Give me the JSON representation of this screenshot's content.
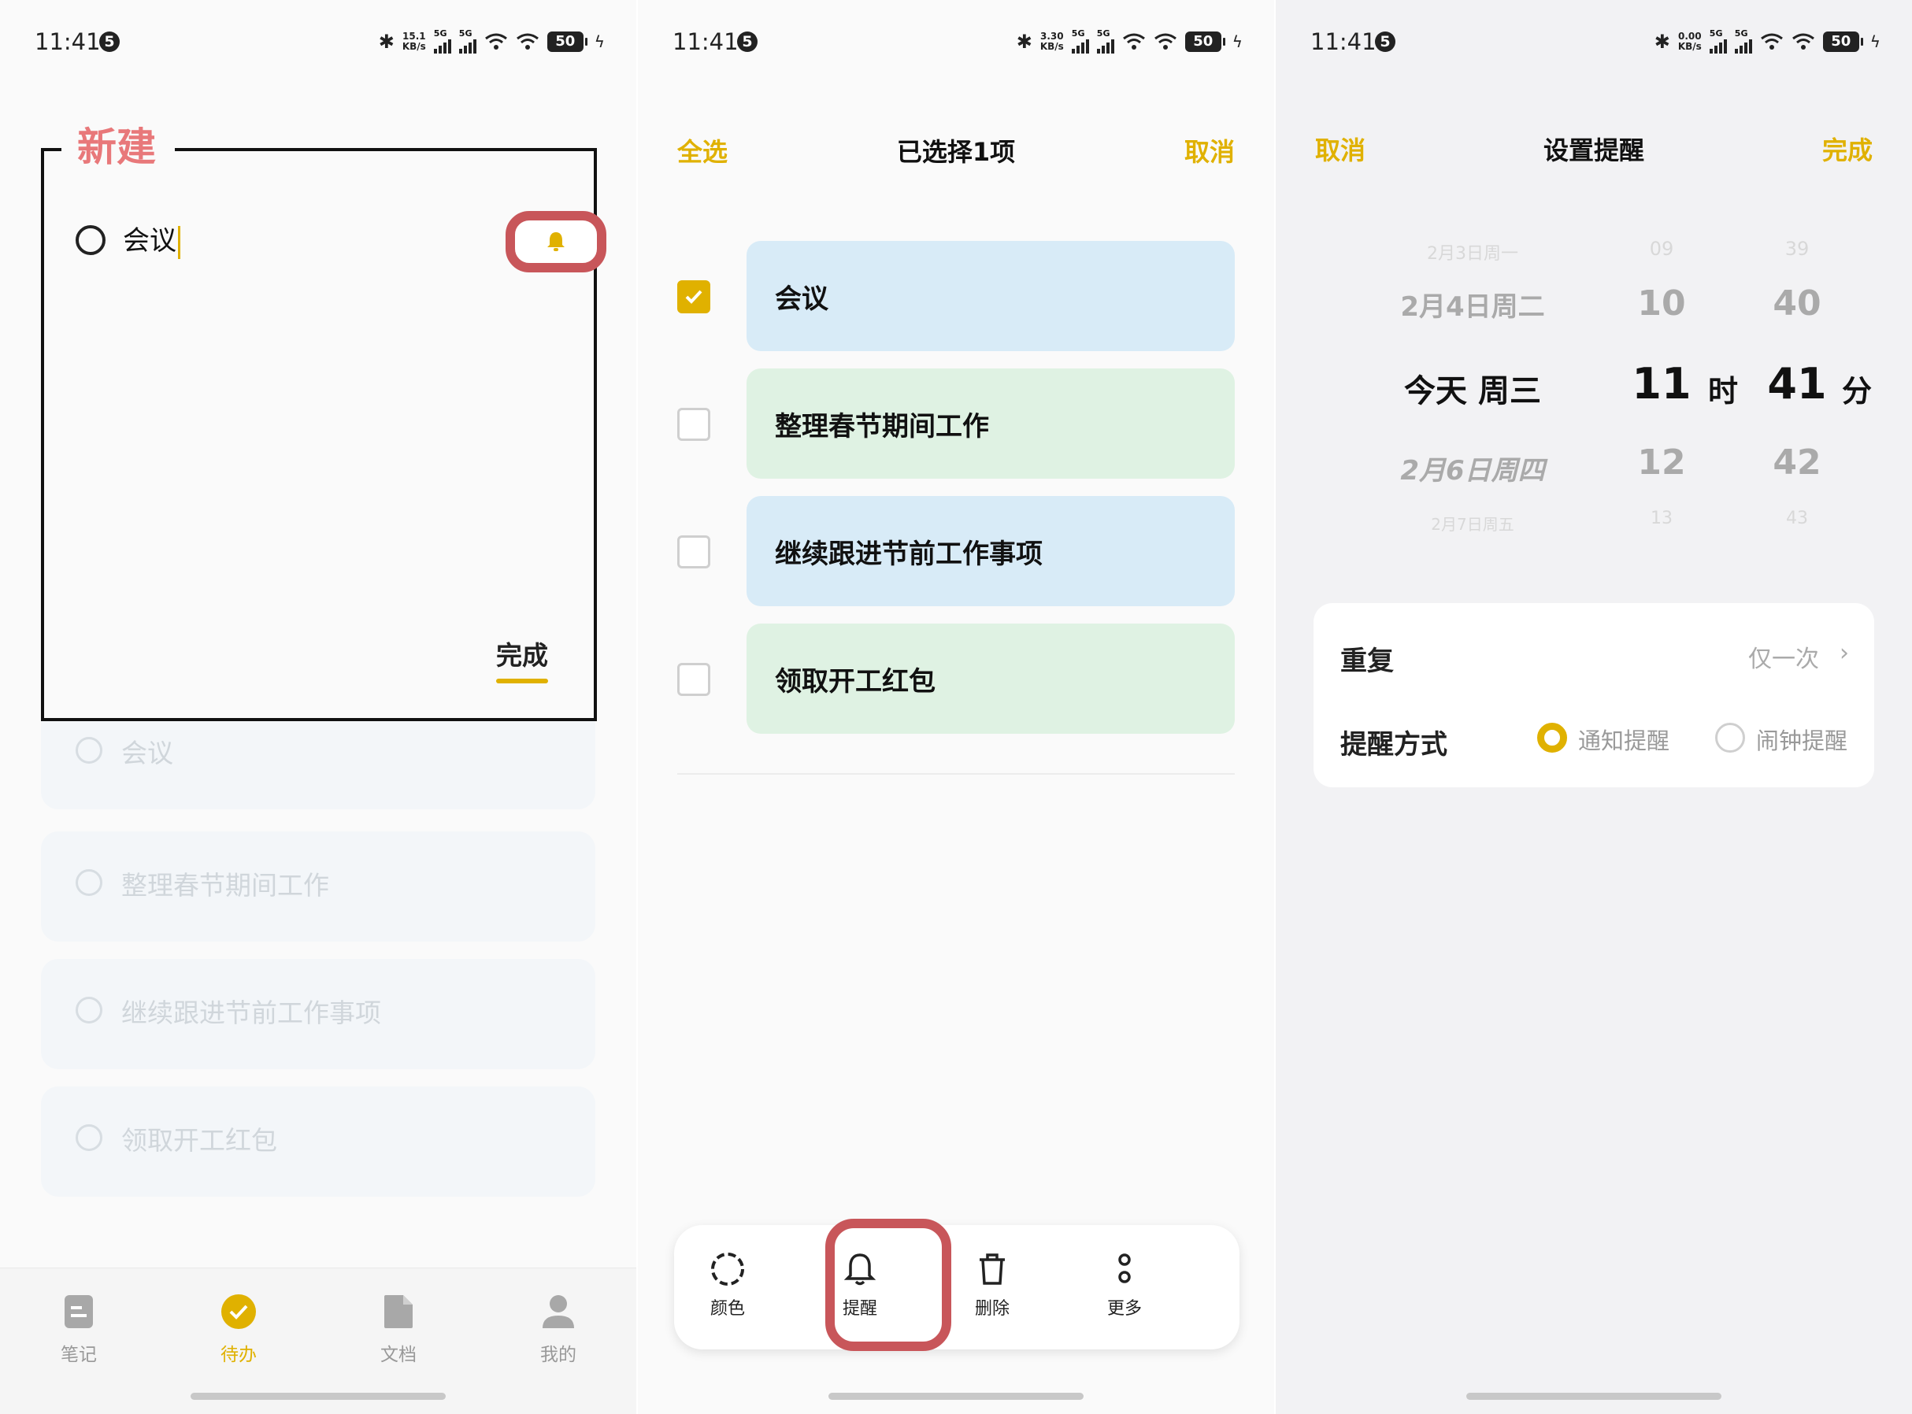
{
  "status": {
    "time": "11:41",
    "badge": "5",
    "speed1": "15.1",
    "speed2": "3.30",
    "speed3": "0.00",
    "speed_unit": "KB/s",
    "net": "5G",
    "battery": "50"
  },
  "panel1": {
    "new_label": "新建",
    "input_value": "会议",
    "done_label": "完成",
    "ghost_items": [
      "会议",
      "整理春节期间工作",
      "继续跟进节前工作事项",
      "领取开工红包"
    ],
    "tabs": [
      {
        "label": "笔记",
        "icon": "note-icon"
      },
      {
        "label": "待办",
        "icon": "check-circle-icon"
      },
      {
        "label": "文档",
        "icon": "document-icon"
      },
      {
        "label": "我的",
        "icon": "person-icon"
      }
    ]
  },
  "panel2": {
    "select_all": "全选",
    "title": "已选择1项",
    "cancel": "取消",
    "items": [
      {
        "label": "会议",
        "checked": true,
        "color": "blue"
      },
      {
        "label": "整理春节期间工作",
        "checked": false,
        "color": "green"
      },
      {
        "label": "继续跟进节前工作事项",
        "checked": false,
        "color": "blue"
      },
      {
        "label": "领取开工红包",
        "checked": false,
        "color": "green"
      }
    ],
    "actions": [
      {
        "label": "颜色",
        "icon": "color-ring-icon"
      },
      {
        "label": "提醒",
        "icon": "bell-icon"
      },
      {
        "label": "删除",
        "icon": "trash-icon"
      },
      {
        "label": "更多",
        "icon": "more-icon"
      }
    ]
  },
  "panel3": {
    "cancel": "取消",
    "title": "设置提醒",
    "done": "完成",
    "dates": [
      "2月3日周一",
      "2月4日周二",
      "今天 周三",
      "2月6日周四",
      "2月7日周五"
    ],
    "hours": [
      "09",
      "10",
      "11",
      "12",
      "13"
    ],
    "minutes": [
      "39",
      "40",
      "41",
      "42",
      "43"
    ],
    "hour_unit": "时",
    "minute_unit": "分",
    "repeat_label": "重复",
    "repeat_value": "仅一次",
    "method_label": "提醒方式",
    "method_notify": "通知提醒",
    "method_alarm": "闹钟提醒"
  },
  "colors": {
    "accent": "#e0b100",
    "new_label": "#e8787a",
    "highlight": "#c8565a",
    "card_blue": "#d8ebf7",
    "card_green": "#dff2e3"
  }
}
